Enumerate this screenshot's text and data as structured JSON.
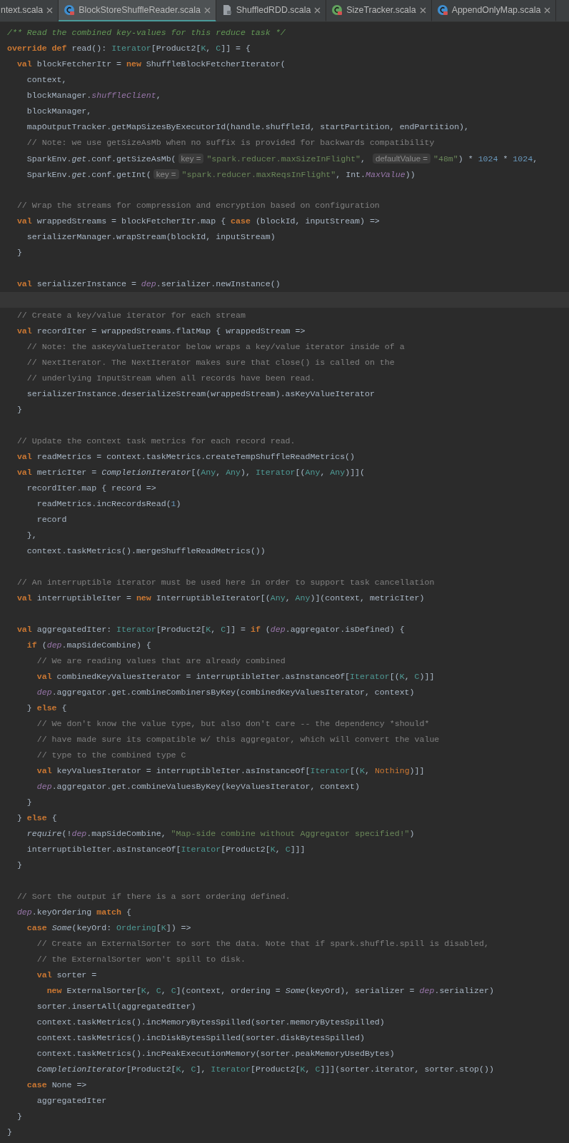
{
  "tabs": [
    {
      "label": "ntext.scala",
      "selected": false
    },
    {
      "label": "BlockStoreShuffleReader.scala",
      "kind": "class",
      "selected": true
    },
    {
      "label": "ShuffledRDD.scala",
      "kind": "file",
      "selected": false
    },
    {
      "label": "SizeTracker.scala",
      "kind": "trait",
      "selected": false
    },
    {
      "label": "AppendOnlyMap.scala",
      "kind": "class",
      "selected": false
    }
  ],
  "editor": {
    "lines": [
      {
        "kind": "code",
        "tokens": [
          {
            "kind": "doc",
            "text": "/** Read the combined key-values for this reduce task */"
          }
        ]
      },
      {
        "kind": "code",
        "tokens": [
          {
            "kind": "keyword",
            "text": "override def"
          },
          {
            "kind": "plain",
            "text": " read(): "
          },
          {
            "kind": "type",
            "text": "Iterator"
          },
          {
            "kind": "plain",
            "text": "[Product2["
          },
          {
            "kind": "type",
            "text": "K"
          },
          {
            "kind": "plain",
            "text": ", "
          },
          {
            "kind": "type",
            "text": "C"
          },
          {
            "kind": "plain",
            "text": "]] = {"
          }
        ]
      },
      {
        "kind": "code",
        "tokens": [
          {
            "kind": "keyword",
            "text": "  val"
          },
          {
            "kind": "plain",
            "text": " blockFetcherItr = "
          },
          {
            "kind": "keyword",
            "text": "new"
          },
          {
            "kind": "plain",
            "text": " ShuffleBlockFetcherIterator("
          }
        ]
      },
      {
        "kind": "code",
        "tokens": [
          {
            "kind": "plain",
            "text": "    context,"
          }
        ]
      },
      {
        "kind": "code",
        "tokens": [
          {
            "kind": "plain",
            "text": "    blockManager."
          },
          {
            "kind": "field",
            "text": "shuffleClient"
          },
          {
            "kind": "plain",
            "text": ","
          }
        ]
      },
      {
        "kind": "code",
        "tokens": [
          {
            "kind": "plain",
            "text": "    blockManager,"
          }
        ]
      },
      {
        "kind": "code",
        "tokens": [
          {
            "kind": "plain",
            "text": "    mapOutputTracker.getMapSizesByExecutorId(handle.shuffleId, startPartition, endPartition),"
          }
        ]
      },
      {
        "kind": "code",
        "tokens": [
          {
            "kind": "comment",
            "text": "    // Note: we use getSizeAsMb when no suffix is provided for backwards compatibility"
          }
        ]
      },
      {
        "kind": "code",
        "tokens": [
          {
            "kind": "plain",
            "text": "    SparkEnv."
          },
          {
            "kind": "italic",
            "text": "get"
          },
          {
            "kind": "plain",
            "text": ".conf.getSizeAsMb("
          },
          {
            "kind": "hint",
            "text": "key ="
          },
          {
            "kind": "string",
            "text": "\"spark.reducer.maxSizeInFlight\""
          },
          {
            "kind": "plain",
            "text": ", "
          },
          {
            "kind": "hint",
            "text": "defaultValue ="
          },
          {
            "kind": "string",
            "text": "\"48m\""
          },
          {
            "kind": "plain",
            "text": ") * "
          },
          {
            "kind": "number",
            "text": "1024"
          },
          {
            "kind": "plain",
            "text": " * "
          },
          {
            "kind": "number",
            "text": "1024"
          },
          {
            "kind": "plain",
            "text": ","
          }
        ]
      },
      {
        "kind": "code",
        "tokens": [
          {
            "kind": "plain",
            "text": "    SparkEnv."
          },
          {
            "kind": "italic",
            "text": "get"
          },
          {
            "kind": "plain",
            "text": ".conf.getInt("
          },
          {
            "kind": "hint",
            "text": "key ="
          },
          {
            "kind": "string",
            "text": "\"spark.reducer.maxReqsInFlight\""
          },
          {
            "kind": "plain",
            "text": ", Int."
          },
          {
            "kind": "field",
            "text": "MaxValue"
          },
          {
            "kind": "plain",
            "text": "))"
          }
        ]
      },
      {
        "kind": "blank"
      },
      {
        "kind": "code",
        "tokens": [
          {
            "kind": "comment",
            "text": "  // Wrap the streams for compression and encryption based on configuration"
          }
        ]
      },
      {
        "kind": "code",
        "tokens": [
          {
            "kind": "keyword",
            "text": "  val"
          },
          {
            "kind": "plain",
            "text": " wrappedStreams = blockFetcherItr.map { "
          },
          {
            "kind": "keyword",
            "text": "case"
          },
          {
            "kind": "plain",
            "text": " (blockId, inputStream) =>"
          }
        ]
      },
      {
        "kind": "code",
        "tokens": [
          {
            "kind": "plain",
            "text": "    serializerManager.wrapStream(blockId, inputStream)"
          }
        ]
      },
      {
        "kind": "code",
        "tokens": [
          {
            "kind": "plain",
            "text": "  }"
          }
        ]
      },
      {
        "kind": "blank"
      },
      {
        "kind": "code",
        "tokens": [
          {
            "kind": "keyword",
            "text": "  val"
          },
          {
            "kind": "plain",
            "text": " serializerInstance = "
          },
          {
            "kind": "field",
            "text": "dep"
          },
          {
            "kind": "plain",
            "text": ".serializer.newInstance()"
          }
        ]
      },
      {
        "kind": "caret"
      },
      {
        "kind": "code",
        "tokens": [
          {
            "kind": "comment",
            "text": "  // Create a key/value iterator for each stream"
          }
        ]
      },
      {
        "kind": "code",
        "tokens": [
          {
            "kind": "keyword",
            "text": "  val"
          },
          {
            "kind": "plain",
            "text": " recordIter = wrappedStreams.flatMap { wrappedStream =>"
          }
        ]
      },
      {
        "kind": "code",
        "tokens": [
          {
            "kind": "comment",
            "text": "    // Note: the asKeyValueIterator below wraps a key/value iterator inside of a"
          }
        ]
      },
      {
        "kind": "code",
        "tokens": [
          {
            "kind": "comment",
            "text": "    // NextIterator. The NextIterator makes sure that close() is called on the"
          }
        ]
      },
      {
        "kind": "code",
        "tokens": [
          {
            "kind": "comment",
            "text": "    // underlying InputStream when all records have been read."
          }
        ]
      },
      {
        "kind": "code",
        "tokens": [
          {
            "kind": "plain",
            "text": "    serializerInstance.deserializeStream(wrappedStream).asKeyValueIterator"
          }
        ]
      },
      {
        "kind": "code",
        "tokens": [
          {
            "kind": "plain",
            "text": "  }"
          }
        ]
      },
      {
        "kind": "blank"
      },
      {
        "kind": "code",
        "tokens": [
          {
            "kind": "comment",
            "text": "  // Update the context task metrics for each record read."
          }
        ]
      },
      {
        "kind": "code",
        "tokens": [
          {
            "kind": "keyword",
            "text": "  val"
          },
          {
            "kind": "plain",
            "text": " readMetrics = context.taskMetrics.createTempShuffleReadMetrics()"
          }
        ]
      },
      {
        "kind": "code",
        "tokens": [
          {
            "kind": "keyword",
            "text": "  val"
          },
          {
            "kind": "plain",
            "text": " metricIter = "
          },
          {
            "kind": "italic",
            "text": "CompletionIterator"
          },
          {
            "kind": "plain",
            "text": "[("
          },
          {
            "kind": "type",
            "text": "Any"
          },
          {
            "kind": "plain",
            "text": ", "
          },
          {
            "kind": "type",
            "text": "Any"
          },
          {
            "kind": "plain",
            "text": "), "
          },
          {
            "kind": "type",
            "text": "Iterator"
          },
          {
            "kind": "plain",
            "text": "[("
          },
          {
            "kind": "type",
            "text": "Any"
          },
          {
            "kind": "plain",
            "text": ", "
          },
          {
            "kind": "type",
            "text": "Any"
          },
          {
            "kind": "plain",
            "text": ")]]("
          }
        ]
      },
      {
        "kind": "code",
        "tokens": [
          {
            "kind": "plain",
            "text": "    recordIter.map { record =>"
          }
        ]
      },
      {
        "kind": "code",
        "tokens": [
          {
            "kind": "plain",
            "text": "      readMetrics.incRecordsRead("
          },
          {
            "kind": "number",
            "text": "1"
          },
          {
            "kind": "plain",
            "text": ")"
          }
        ]
      },
      {
        "kind": "code",
        "tokens": [
          {
            "kind": "plain",
            "text": "      record"
          }
        ]
      },
      {
        "kind": "code",
        "tokens": [
          {
            "kind": "plain",
            "text": "    },"
          }
        ]
      },
      {
        "kind": "code",
        "tokens": [
          {
            "kind": "plain",
            "text": "    context.taskMetrics().mergeShuffleReadMetrics())"
          }
        ]
      },
      {
        "kind": "blank"
      },
      {
        "kind": "code",
        "tokens": [
          {
            "kind": "comment",
            "text": "  // An interruptible iterator must be used here in order to support task cancellation"
          }
        ]
      },
      {
        "kind": "code",
        "tokens": [
          {
            "kind": "keyword",
            "text": "  val"
          },
          {
            "kind": "plain",
            "text": " interruptibleIter = "
          },
          {
            "kind": "keyword",
            "text": "new"
          },
          {
            "kind": "plain",
            "text": " InterruptibleIterator[("
          },
          {
            "kind": "type",
            "text": "Any"
          },
          {
            "kind": "plain",
            "text": ", "
          },
          {
            "kind": "type",
            "text": "Any"
          },
          {
            "kind": "plain",
            "text": ")](context, metricIter)"
          }
        ]
      },
      {
        "kind": "blank"
      },
      {
        "kind": "code",
        "tokens": [
          {
            "kind": "keyword",
            "text": "  val"
          },
          {
            "kind": "plain",
            "text": " aggregatedIter: "
          },
          {
            "kind": "type",
            "text": "Iterator"
          },
          {
            "kind": "plain",
            "text": "[Product2["
          },
          {
            "kind": "type",
            "text": "K"
          },
          {
            "kind": "plain",
            "text": ", "
          },
          {
            "kind": "type",
            "text": "C"
          },
          {
            "kind": "plain",
            "text": "]] = "
          },
          {
            "kind": "keyword",
            "text": "if"
          },
          {
            "kind": "plain",
            "text": " ("
          },
          {
            "kind": "field",
            "text": "dep"
          },
          {
            "kind": "plain",
            "text": ".aggregator.isDefined) {"
          }
        ]
      },
      {
        "kind": "code",
        "tokens": [
          {
            "kind": "keyword",
            "text": "    if"
          },
          {
            "kind": "plain",
            "text": " ("
          },
          {
            "kind": "field",
            "text": "dep"
          },
          {
            "kind": "plain",
            "text": ".mapSideCombine) {"
          }
        ]
      },
      {
        "kind": "code",
        "tokens": [
          {
            "kind": "comment",
            "text": "      // We are reading values that are already combined"
          }
        ]
      },
      {
        "kind": "code",
        "tokens": [
          {
            "kind": "keyword",
            "text": "      val"
          },
          {
            "kind": "plain",
            "text": " combinedKeyValuesIterator = interruptibleIter.asInstanceOf["
          },
          {
            "kind": "type",
            "text": "Iterator"
          },
          {
            "kind": "plain",
            "text": "[("
          },
          {
            "kind": "type",
            "text": "K"
          },
          {
            "kind": "plain",
            "text": ", "
          },
          {
            "kind": "type",
            "text": "C"
          },
          {
            "kind": "plain",
            "text": ")]]"
          }
        ]
      },
      {
        "kind": "code",
        "tokens": [
          {
            "kind": "field",
            "text": "      dep"
          },
          {
            "kind": "plain",
            "text": ".aggregator.get.combineCombinersByKey(combinedKeyValuesIterator, context)"
          }
        ]
      },
      {
        "kind": "code",
        "tokens": [
          {
            "kind": "plain",
            "text": "    } "
          },
          {
            "kind": "keyword",
            "text": "else"
          },
          {
            "kind": "plain",
            "text": " {"
          }
        ]
      },
      {
        "kind": "code",
        "tokens": [
          {
            "kind": "comment",
            "text": "      // We don't know the value type, but also don't care -- the dependency *should*"
          }
        ]
      },
      {
        "kind": "code",
        "tokens": [
          {
            "kind": "comment",
            "text": "      // have made sure its compatible w/ this aggregator, which will convert the value"
          }
        ]
      },
      {
        "kind": "code",
        "tokens": [
          {
            "kind": "comment",
            "text": "      // type to the combined type C"
          }
        ]
      },
      {
        "kind": "code",
        "tokens": [
          {
            "kind": "keyword",
            "text": "      val"
          },
          {
            "kind": "plain",
            "text": " keyValuesIterator = interruptibleIter.asInstanceOf["
          },
          {
            "kind": "type",
            "text": "Iterator"
          },
          {
            "kind": "plain",
            "text": "[("
          },
          {
            "kind": "type",
            "text": "K"
          },
          {
            "kind": "plain",
            "text": ", "
          },
          {
            "kind": "builtin",
            "text": "Nothing"
          },
          {
            "kind": "plain",
            "text": ")]]"
          }
        ]
      },
      {
        "kind": "code",
        "tokens": [
          {
            "kind": "field",
            "text": "      dep"
          },
          {
            "kind": "plain",
            "text": ".aggregator.get.combineValuesByKey(keyValuesIterator, context)"
          }
        ]
      },
      {
        "kind": "code",
        "tokens": [
          {
            "kind": "plain",
            "text": "    }"
          }
        ]
      },
      {
        "kind": "code",
        "tokens": [
          {
            "kind": "plain",
            "text": "  } "
          },
          {
            "kind": "keyword",
            "text": "else"
          },
          {
            "kind": "plain",
            "text": " {"
          }
        ]
      },
      {
        "kind": "code",
        "tokens": [
          {
            "kind": "italic",
            "text": "    require"
          },
          {
            "kind": "plain",
            "text": "(!"
          },
          {
            "kind": "field",
            "text": "dep"
          },
          {
            "kind": "plain",
            "text": ".mapSideCombine, "
          },
          {
            "kind": "string",
            "text": "\"Map-side combine without Aggregator specified!\""
          },
          {
            "kind": "plain",
            "text": ")"
          }
        ]
      },
      {
        "kind": "code",
        "tokens": [
          {
            "kind": "plain",
            "text": "    interruptibleIter.asInstanceOf["
          },
          {
            "kind": "type",
            "text": "Iterator"
          },
          {
            "kind": "plain",
            "text": "[Product2["
          },
          {
            "kind": "type",
            "text": "K"
          },
          {
            "kind": "plain",
            "text": ", "
          },
          {
            "kind": "type",
            "text": "C"
          },
          {
            "kind": "plain",
            "text": "]]]"
          }
        ]
      },
      {
        "kind": "code",
        "tokens": [
          {
            "kind": "plain",
            "text": "  }"
          }
        ]
      },
      {
        "kind": "blank"
      },
      {
        "kind": "code",
        "tokens": [
          {
            "kind": "comment",
            "text": "  // Sort the output if there is a sort ordering defined."
          }
        ]
      },
      {
        "kind": "code",
        "tokens": [
          {
            "kind": "field",
            "text": "  dep"
          },
          {
            "kind": "plain",
            "text": ".keyOrdering "
          },
          {
            "kind": "keyword",
            "text": "match"
          },
          {
            "kind": "plain",
            "text": " {"
          }
        ]
      },
      {
        "kind": "code",
        "tokens": [
          {
            "kind": "keyword",
            "text": "    case"
          },
          {
            "kind": "italic",
            "text": " Some"
          },
          {
            "kind": "plain",
            "text": "(keyOrd: "
          },
          {
            "kind": "type",
            "text": "Ordering"
          },
          {
            "kind": "plain",
            "text": "["
          },
          {
            "kind": "type",
            "text": "K"
          },
          {
            "kind": "plain",
            "text": "]) =>"
          }
        ]
      },
      {
        "kind": "code",
        "tokens": [
          {
            "kind": "comment",
            "text": "      // Create an ExternalSorter to sort the data. Note that if spark.shuffle.spill is disabled,"
          }
        ]
      },
      {
        "kind": "code",
        "tokens": [
          {
            "kind": "comment",
            "text": "      // the ExternalSorter won't spill to disk."
          }
        ]
      },
      {
        "kind": "code",
        "tokens": [
          {
            "kind": "keyword",
            "text": "      val"
          },
          {
            "kind": "plain",
            "text": " sorter ="
          }
        ]
      },
      {
        "kind": "code",
        "tokens": [
          {
            "kind": "keyword",
            "text": "        new"
          },
          {
            "kind": "plain",
            "text": " ExternalSorter["
          },
          {
            "kind": "type",
            "text": "K"
          },
          {
            "kind": "plain",
            "text": ", "
          },
          {
            "kind": "type",
            "text": "C"
          },
          {
            "kind": "plain",
            "text": ", "
          },
          {
            "kind": "type",
            "text": "C"
          },
          {
            "kind": "plain",
            "text": "](context, ordering = "
          },
          {
            "kind": "italic",
            "text": "Some"
          },
          {
            "kind": "plain",
            "text": "(keyOrd), serializer = "
          },
          {
            "kind": "field",
            "text": "dep"
          },
          {
            "kind": "plain",
            "text": ".serializer)"
          }
        ]
      },
      {
        "kind": "code",
        "tokens": [
          {
            "kind": "plain",
            "text": "      sorter.insertAll(aggregatedIter)"
          }
        ]
      },
      {
        "kind": "code",
        "tokens": [
          {
            "kind": "plain",
            "text": "      context.taskMetrics().incMemoryBytesSpilled(sorter.memoryBytesSpilled)"
          }
        ]
      },
      {
        "kind": "code",
        "tokens": [
          {
            "kind": "plain",
            "text": "      context.taskMetrics().incDiskBytesSpilled(sorter.diskBytesSpilled)"
          }
        ]
      },
      {
        "kind": "code",
        "tokens": [
          {
            "kind": "plain",
            "text": "      context.taskMetrics().incPeakExecutionMemory(sorter.peakMemoryUsedBytes)"
          }
        ]
      },
      {
        "kind": "code",
        "tokens": [
          {
            "kind": "italic",
            "text": "      CompletionIterator"
          },
          {
            "kind": "plain",
            "text": "[Product2["
          },
          {
            "kind": "type",
            "text": "K"
          },
          {
            "kind": "plain",
            "text": ", "
          },
          {
            "kind": "type",
            "text": "C"
          },
          {
            "kind": "plain",
            "text": "], "
          },
          {
            "kind": "type",
            "text": "Iterator"
          },
          {
            "kind": "plain",
            "text": "[Product2["
          },
          {
            "kind": "type",
            "text": "K"
          },
          {
            "kind": "plain",
            "text": ", "
          },
          {
            "kind": "type",
            "text": "C"
          },
          {
            "kind": "plain",
            "text": "]]](sorter.iterator, sorter.stop())"
          }
        ]
      },
      {
        "kind": "code",
        "tokens": [
          {
            "kind": "keyword",
            "text": "    case"
          },
          {
            "kind": "plain",
            "text": " None =>"
          }
        ]
      },
      {
        "kind": "code",
        "tokens": [
          {
            "kind": "plain",
            "text": "      aggregatedIter"
          }
        ]
      },
      {
        "kind": "code",
        "tokens": [
          {
            "kind": "plain",
            "text": "  }"
          }
        ]
      },
      {
        "kind": "code",
        "tokens": [
          {
            "kind": "plain",
            "text": "}"
          }
        ]
      }
    ]
  }
}
